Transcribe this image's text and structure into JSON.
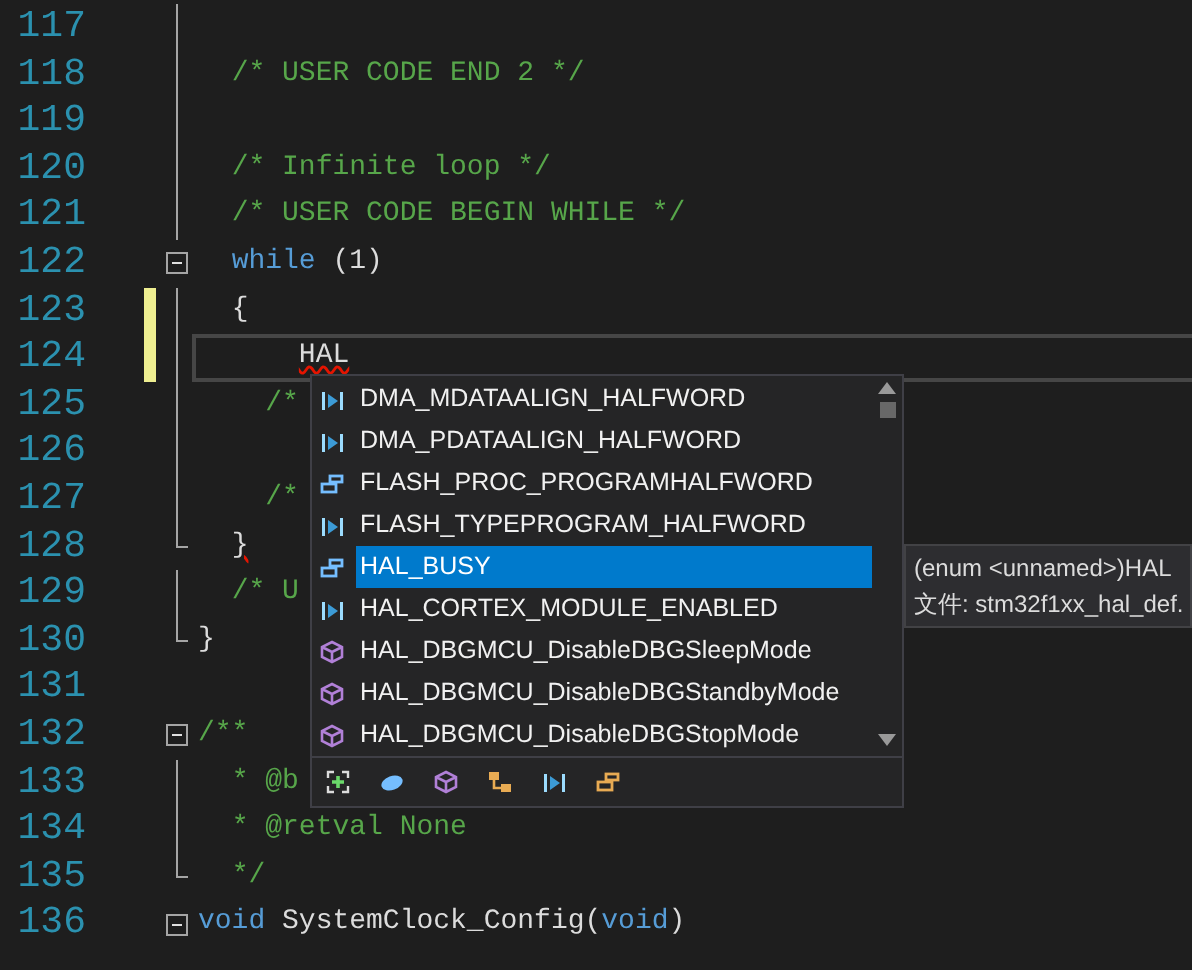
{
  "editor": {
    "lines": [
      {
        "number": "117",
        "in_fold": true
      },
      {
        "number": "118",
        "in_fold": true,
        "tokens": [
          {
            "kind": "comment",
            "text": "  /* USER CODE END 2 */"
          }
        ]
      },
      {
        "number": "119",
        "in_fold": true
      },
      {
        "number": "120",
        "in_fold": true,
        "tokens": [
          {
            "kind": "comment",
            "text": "  /* Infinite loop */"
          }
        ]
      },
      {
        "number": "121",
        "in_fold": true,
        "tokens": [
          {
            "kind": "comment",
            "text": "  /* USER CODE BEGIN WHILE */"
          }
        ]
      },
      {
        "number": "122",
        "fold_button": true,
        "tokens": [
          {
            "kind": "keyword",
            "text": "  while"
          },
          {
            "kind": "plain",
            "text": " (1)"
          }
        ]
      },
      {
        "number": "123",
        "in_fold": true,
        "changed": true,
        "tokens": [
          {
            "kind": "plain",
            "text": "  {"
          }
        ]
      },
      {
        "number": "124",
        "in_fold": true,
        "changed": true,
        "current": true,
        "tokens": [
          {
            "kind": "plain",
            "text": "      HAL",
            "error": true
          }
        ]
      },
      {
        "number": "125",
        "in_fold": true,
        "tokens": [
          {
            "kind": "comment",
            "text": "    /*"
          }
        ]
      },
      {
        "number": "126",
        "in_fold": true
      },
      {
        "number": "127",
        "in_fold": true,
        "tokens": [
          {
            "kind": "comment",
            "text": "    /*"
          }
        ]
      },
      {
        "number": "128",
        "fold_end": true,
        "tokens": [
          {
            "kind": "plain",
            "text": "  }",
            "error": true
          }
        ]
      },
      {
        "number": "129",
        "in_fold": true,
        "tokens": [
          {
            "kind": "comment",
            "text": "  /* U"
          }
        ]
      },
      {
        "number": "130",
        "fold_end": true,
        "tokens": [
          {
            "kind": "plain",
            "text": "}"
          }
        ]
      },
      {
        "number": "131"
      },
      {
        "number": "132",
        "fold_button": true,
        "tokens": [
          {
            "kind": "comment",
            "text": "/**"
          }
        ]
      },
      {
        "number": "133",
        "in_fold": true,
        "tokens": [
          {
            "kind": "comment",
            "text": "  * @b"
          }
        ]
      },
      {
        "number": "134",
        "in_fold": true,
        "tokens": [
          {
            "kind": "comment",
            "text": "  * @retval None"
          }
        ]
      },
      {
        "number": "135",
        "fold_end": true,
        "tokens": [
          {
            "kind": "comment",
            "text": "  */"
          }
        ]
      },
      {
        "number": "136",
        "fold_button": true,
        "tokens": [
          {
            "kind": "keyword",
            "text": "void"
          },
          {
            "kind": "plain",
            "text": " SystemClock_Config("
          },
          {
            "kind": "keyword",
            "text": "void"
          },
          {
            "kind": "plain",
            "text": ")"
          }
        ]
      }
    ]
  },
  "completion": {
    "items": [
      {
        "label": "DMA_MDATAALIGN_HALFWORD",
        "kind": "member",
        "selected": false
      },
      {
        "label": "DMA_PDATAALIGN_HALFWORD",
        "kind": "member",
        "selected": false
      },
      {
        "label": "FLASH_PROC_PROGRAMHALFWORD",
        "kind": "enum",
        "selected": false
      },
      {
        "label": "FLASH_TYPEPROGRAM_HALFWORD",
        "kind": "member",
        "selected": false
      },
      {
        "label": "HAL_BUSY",
        "kind": "enum",
        "selected": true
      },
      {
        "label": "HAL_CORTEX_MODULE_ENABLED",
        "kind": "member",
        "selected": false
      },
      {
        "label": "HAL_DBGMCU_DisableDBGSleepMode",
        "kind": "function",
        "selected": false
      },
      {
        "label": "HAL_DBGMCU_DisableDBGStandbyMode",
        "kind": "function",
        "selected": false
      },
      {
        "label": "HAL_DBGMCU_DisableDBGStopMode",
        "kind": "function",
        "selected": false
      }
    ],
    "filters": [
      {
        "kind": "expand"
      },
      {
        "kind": "namespace"
      },
      {
        "kind": "function"
      },
      {
        "kind": "class"
      },
      {
        "kind": "member"
      },
      {
        "kind": "enum"
      }
    ]
  },
  "tooltip": {
    "lines": [
      "(enum <unnamed>)HAL",
      "文件: stm32f1xx_hal_def."
    ]
  }
}
